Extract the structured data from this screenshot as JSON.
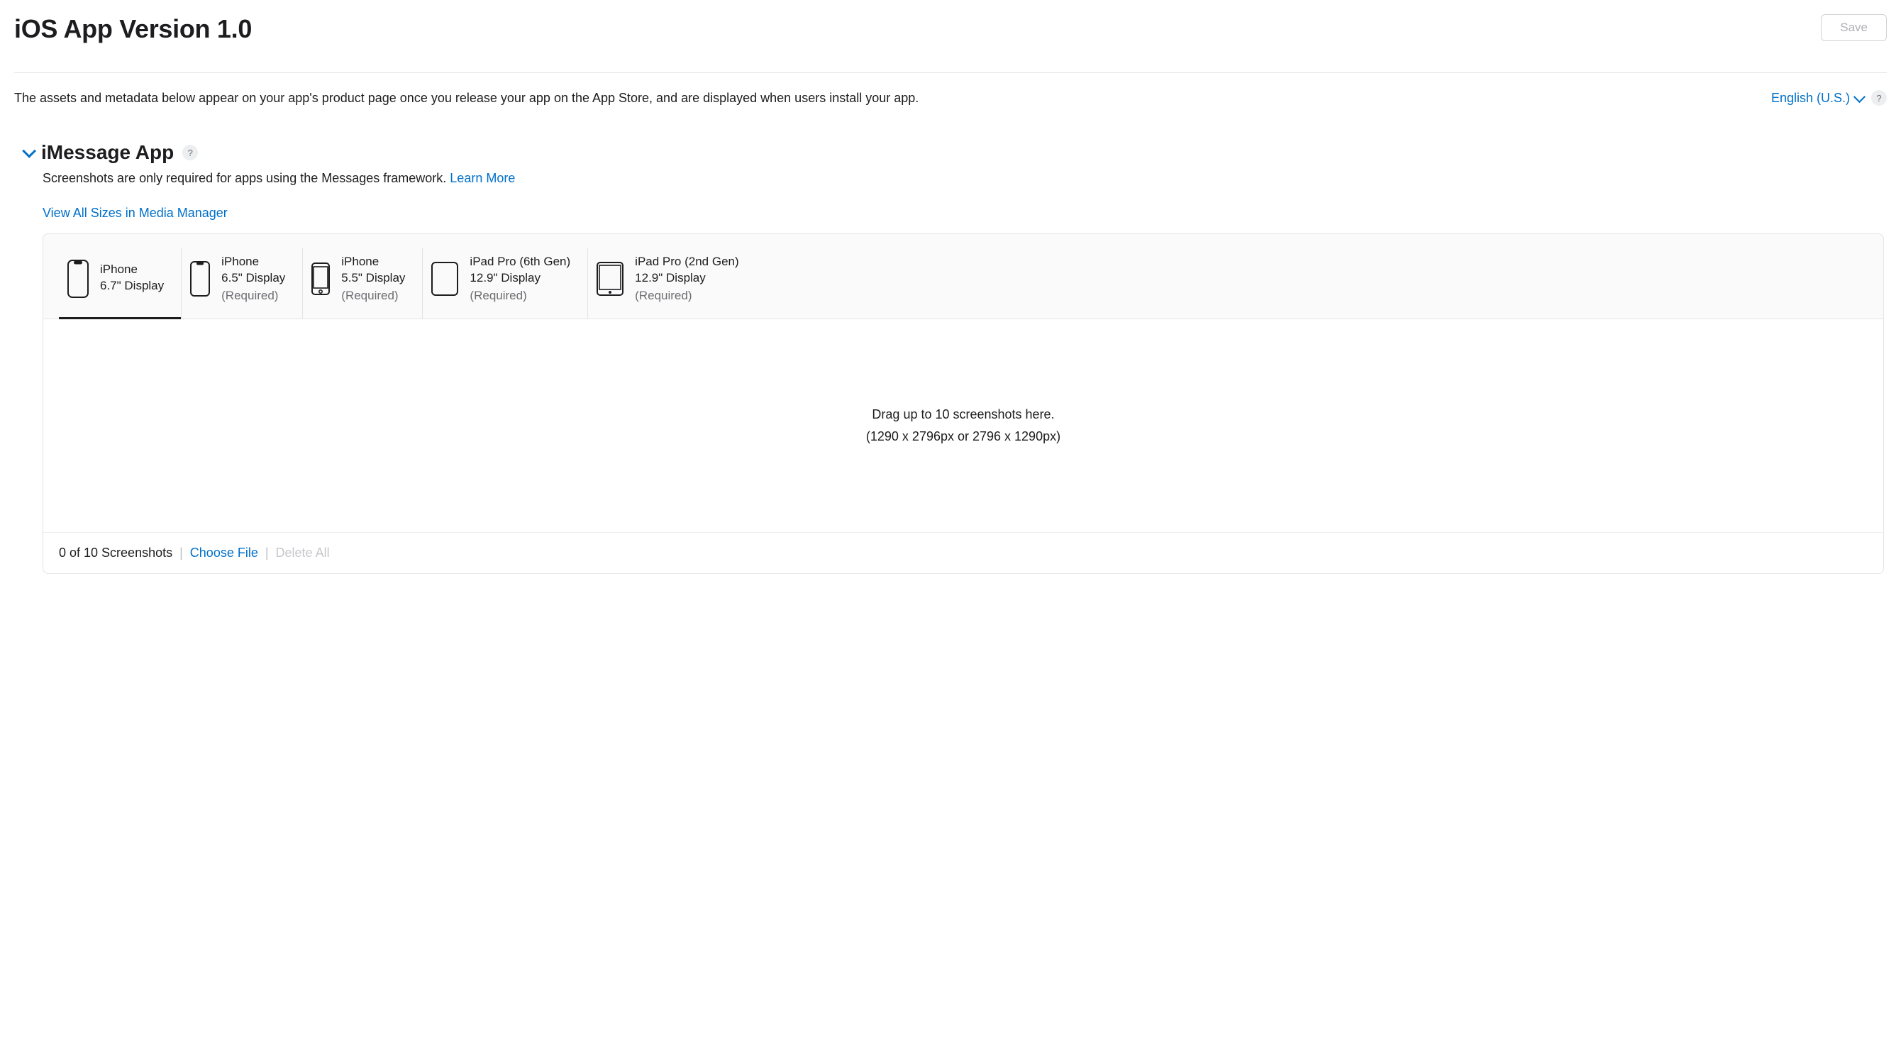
{
  "header": {
    "title": "iOS App Version 1.0",
    "save_label": "Save"
  },
  "meta": {
    "description": "The assets and metadata below appear on your app's product page once you release your app on the App Store, and are displayed when users install your app.",
    "language": "English (U.S.)"
  },
  "section": {
    "title": "iMessage App",
    "description_prefix": "Screenshots are only required for apps using the Messages framework. ",
    "learn_more": "Learn More",
    "view_all_sizes": "View All Sizes in Media Manager"
  },
  "tabs": [
    {
      "line1": "iPhone",
      "line2": "6.7\" Display",
      "required": "",
      "active": true
    },
    {
      "line1": "iPhone",
      "line2": "6.5\" Display",
      "required": "(Required)",
      "active": false
    },
    {
      "line1": "iPhone",
      "line2": "5.5\" Display",
      "required": "(Required)",
      "active": false
    },
    {
      "line1": "iPad Pro (6th Gen)",
      "line2": "12.9\" Display",
      "required": "(Required)",
      "active": false
    },
    {
      "line1": "iPad Pro (2nd Gen)",
      "line2": "12.9\" Display",
      "required": "(Required)",
      "active": false
    }
  ],
  "dropzone": {
    "line1": "Drag up to 10 screenshots here.",
    "line2": "(1290 x 2796px or 2796 x 1290px)"
  },
  "footer": {
    "count": "0 of 10 Screenshots",
    "choose_file": "Choose File",
    "delete_all": "Delete All"
  }
}
